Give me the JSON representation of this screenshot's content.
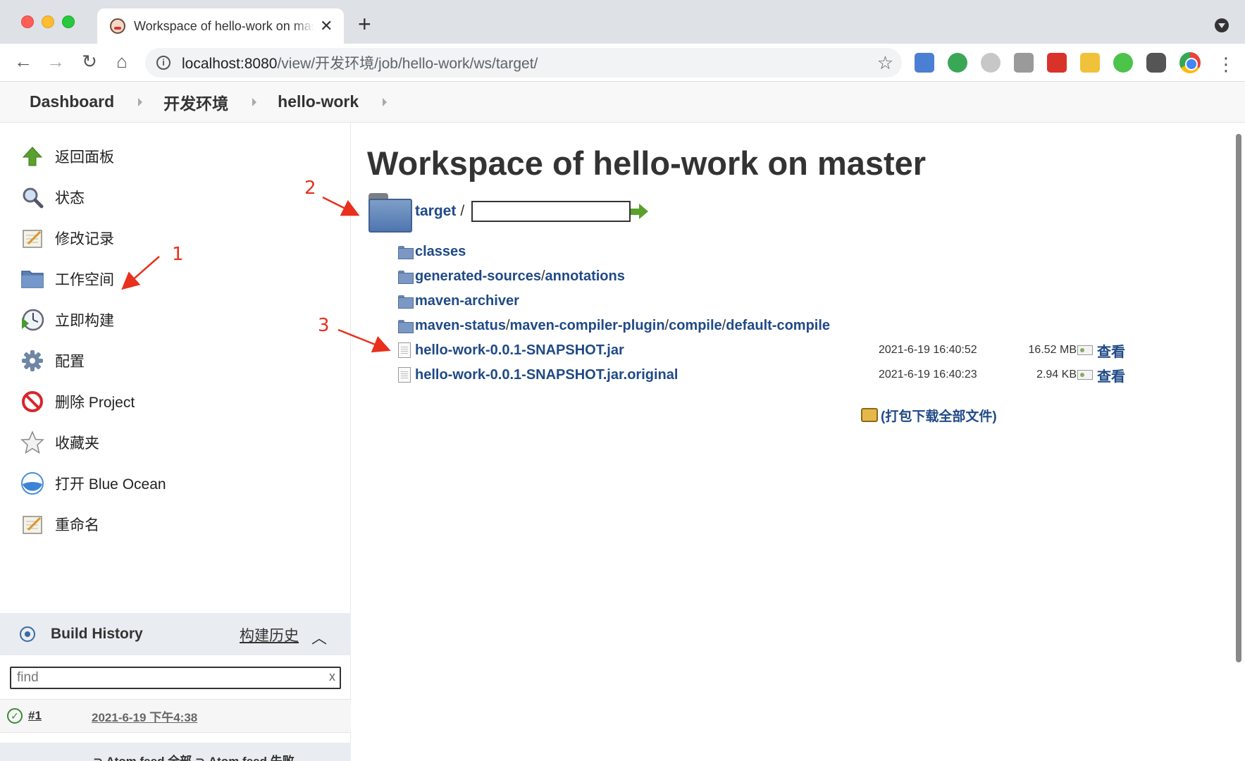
{
  "browser": {
    "tab_title": "Workspace of hello-work on master",
    "url_host_port": "localhost:8080",
    "url_path": "/view/开发环境/job/hello-work/ws/target/"
  },
  "breadcrumbs": [
    "Dashboard",
    "开发环境",
    "hello-work"
  ],
  "side_tasks": [
    {
      "label": "返回面板",
      "icon": "up-arrow-icon"
    },
    {
      "label": "状态",
      "icon": "search-icon"
    },
    {
      "label": "修改记录",
      "icon": "notepad-icon"
    },
    {
      "label": "工作空间",
      "icon": "folder-icon"
    },
    {
      "label": "立即构建",
      "icon": "build-clock-icon"
    },
    {
      "label": "配置",
      "icon": "gear-icon"
    },
    {
      "label": "删除 Project",
      "icon": "no-entry-icon"
    },
    {
      "label": "收藏夹",
      "icon": "star-icon"
    },
    {
      "label": "打开 Blue Ocean",
      "icon": "blue-ocean-icon"
    },
    {
      "label": "重命名",
      "icon": "notepad-icon"
    }
  ],
  "build_history": {
    "title": "Build History",
    "link": "构建历史",
    "filter_placeholder": "find",
    "filter_clear": "x",
    "builds": [
      {
        "number": "#1",
        "time": "2021-6-19 下午4:38"
      }
    ],
    "feeds": "⊃ Atom feed 全部  ⊃ Atom feed 失败"
  },
  "main": {
    "title": "Workspace of hello-work on master",
    "path": {
      "dir": "target",
      "slash": "/"
    },
    "folders": [
      {
        "parts": [
          "classes"
        ]
      },
      {
        "parts": [
          "generated-sources",
          "annotations"
        ]
      },
      {
        "parts": [
          "maven-archiver"
        ]
      },
      {
        "parts": [
          "maven-status",
          "maven-compiler-plugin",
          "compile",
          "default-compile"
        ]
      }
    ],
    "files": [
      {
        "name": "hello-work-0.0.1-SNAPSHOT.jar",
        "date": "2021-6-19 16:40:52",
        "size": "16.52 MB",
        "view": "查看"
      },
      {
        "name": "hello-work-0.0.1-SNAPSHOT.jar.original",
        "date": "2021-6-19 16:40:23",
        "size": "2.94 KB",
        "view": "查看"
      }
    ],
    "zip_link": "(打包下载全部文件)"
  },
  "annotations": [
    "1",
    "2",
    "3"
  ],
  "colors": {
    "link": "#204a87",
    "annotation": "#e8301c"
  }
}
